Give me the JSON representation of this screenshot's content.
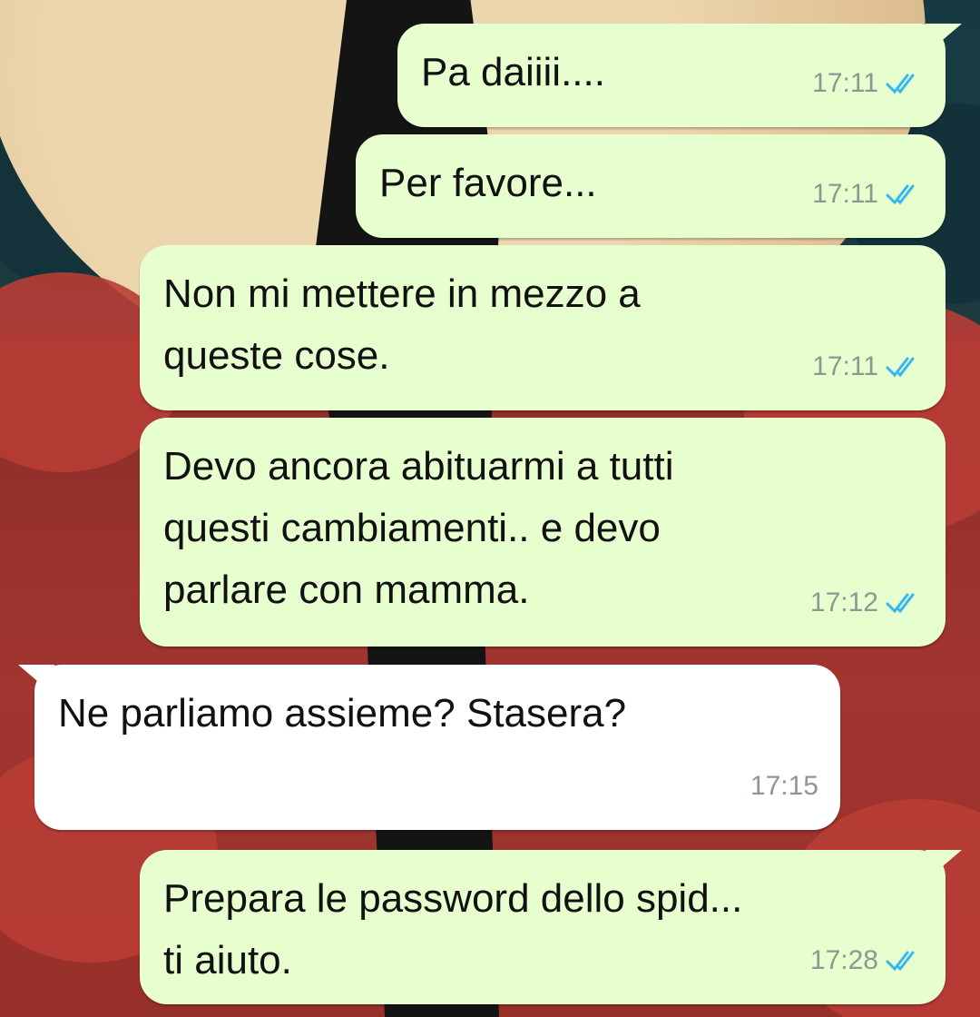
{
  "chat": {
    "messages": [
      {
        "direction": "out",
        "text": "Pa daiiii....",
        "time": "17:11",
        "status": "read-double-check-icon"
      },
      {
        "direction": "out",
        "text": "Per favore...",
        "time": "17:11",
        "status": "read-double-check-icon"
      },
      {
        "direction": "out",
        "text": "Non mi mettere in mezzo a\nqueste cose.",
        "time": "17:11",
        "status": "read-double-check-icon"
      },
      {
        "direction": "out",
        "text": "Devo ancora abituarmi a tutti\nquesti cambiamenti.. e devo\nparlare con mamma.",
        "time": "17:12",
        "status": "read-double-check-icon"
      },
      {
        "direction": "in",
        "text": "Ne parliamo assieme? Stasera?",
        "time": "17:15"
      },
      {
        "direction": "out",
        "text": "Prepara le password dello spid...\nti aiuto.",
        "time": "17:28",
        "status": "read-double-check-icon"
      }
    ]
  },
  "colors": {
    "outgoing_bubble": "#e7fece",
    "incoming_bubble": "#ffffff",
    "read_tick": "#34b7f1",
    "timestamp": "#8f9791"
  }
}
